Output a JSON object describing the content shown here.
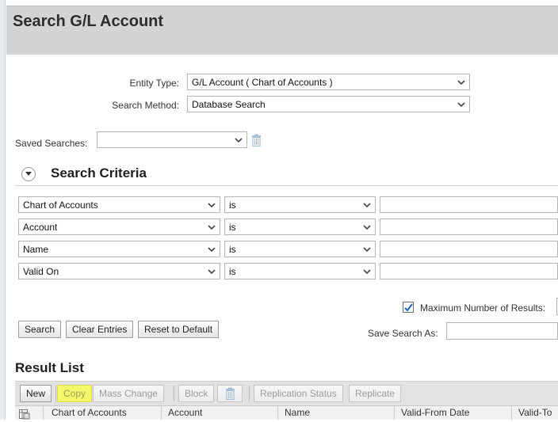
{
  "page": {
    "title": "Search G/L Account"
  },
  "form": {
    "entity_type_label": "Entity Type:",
    "entity_type_value": "G/L Account ( Chart of Accounts )",
    "search_method_label": "Search Method:",
    "search_method_value": "Database Search",
    "saved_searches_label": "Saved Searches:",
    "saved_searches_value": ""
  },
  "criteria": {
    "title": "Search Criteria",
    "rows": [
      {
        "field": "Chart of Accounts",
        "operator": "is",
        "value": ""
      },
      {
        "field": "Account",
        "operator": "is",
        "value": ""
      },
      {
        "field": "Name",
        "operator": "is",
        "value": ""
      },
      {
        "field": "Valid On",
        "operator": "is",
        "value": ""
      }
    ],
    "max_results_label": "Maximum Number of Results:",
    "max_results_checked": true,
    "save_search_as_label": "Save Search As:",
    "buttons": {
      "search": "Search",
      "clear": "Clear Entries",
      "reset": "Reset to Default"
    }
  },
  "results": {
    "title": "Result List",
    "toolbar": {
      "new": "New",
      "copy": "Copy",
      "mass_change": "Mass Change",
      "block": "Block",
      "replication_status": "Replication Status",
      "replicate": "Replicate"
    },
    "columns": [
      "Chart of Accounts",
      "Account",
      "Name",
      "Valid-From Date",
      "Valid-To"
    ]
  },
  "colors": {
    "highlight": "#f4f76a",
    "header_band": "#d4d4d4",
    "checkbox_mark": "#1a5fb4"
  },
  "icons": [
    "chevron-down-icon",
    "trash-icon",
    "collapse-toggle-icon",
    "checkmark-icon",
    "table-settings-icon"
  ]
}
